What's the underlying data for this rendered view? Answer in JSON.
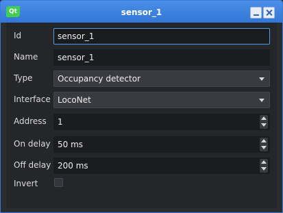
{
  "window": {
    "title": "sensor_1",
    "logo_text": "Qt"
  },
  "form": {
    "id": {
      "label": "Id",
      "value": "sensor_1"
    },
    "name": {
      "label": "Name",
      "value": "sensor_1"
    },
    "type": {
      "label": "Type",
      "value": "Occupancy detector"
    },
    "interface": {
      "label": "Interface",
      "value": "LocoNet"
    },
    "address": {
      "label": "Address",
      "value": "1"
    },
    "on_delay": {
      "label": "On delay",
      "value": "50 ms"
    },
    "off_delay": {
      "label": "Off delay",
      "value": "200 ms"
    },
    "invert": {
      "label": "Invert",
      "checked": false
    }
  },
  "colors": {
    "titlebar": "#3a7bd5",
    "background": "#25262a",
    "focus": "#4f9eea"
  }
}
